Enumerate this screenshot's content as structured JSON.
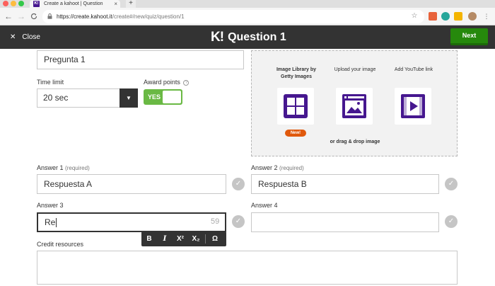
{
  "browser": {
    "tab_title": "Create a kahoot | Question",
    "url_host": "https://create.kahoot.it",
    "url_path": "/create#/new/quiz/question/1",
    "favicon_letter": "K!",
    "new_tab_symbol": "+",
    "tab_close_symbol": "×",
    "back_symbol": "←",
    "forward_symbol": "→",
    "reload_symbol": "C"
  },
  "header": {
    "close_label": "Close",
    "close_symbol": "✕",
    "logo": "K!",
    "title": "Question 1",
    "next_label": "Next"
  },
  "question": {
    "value": "Pregunta 1"
  },
  "time_limit": {
    "label": "Time limit",
    "value": "20 sec",
    "arrow": "▼"
  },
  "award_points": {
    "label": "Award points",
    "help": "?",
    "toggle_text": "YES"
  },
  "media": {
    "library_label": "Image Library by Getty Images",
    "upload_label": "Upload your image",
    "youtube_label": "Add YouTube link",
    "new_badge": "New!",
    "drag_label": "or drag & drop image"
  },
  "answers": {
    "required_text": "(required)",
    "a1": {
      "label": "Answer 1",
      "value": "Respuesta A"
    },
    "a2": {
      "label": "Answer 2",
      "value": "Respuesta B"
    },
    "a3": {
      "label": "Answer 3",
      "value": "Re",
      "counter": "59"
    },
    "a4": {
      "label": "Answer 4",
      "value": ""
    },
    "check_symbol": "✓"
  },
  "format_toolbar": {
    "bold": "B",
    "italic": "I",
    "sup": "X²",
    "sub": "X₂",
    "omega": "Ω"
  },
  "credit": {
    "label": "Credit resources"
  },
  "colors": {
    "accent_purple": "#46178f",
    "next_green": "#26890c",
    "toggle_green": "#6ab944",
    "header_dark": "#333333"
  }
}
